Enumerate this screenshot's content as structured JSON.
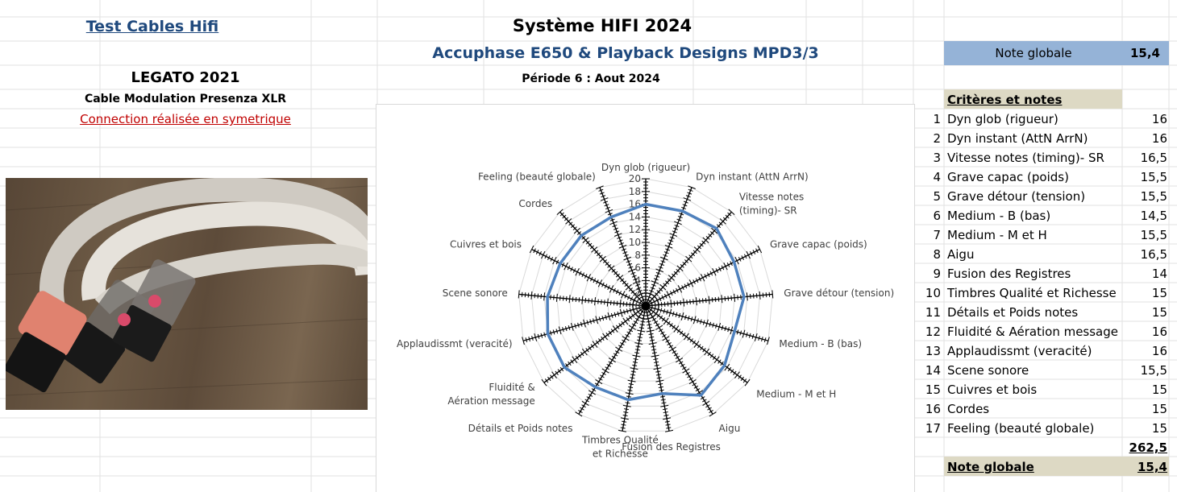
{
  "header": {
    "left_title": "Test Cables Hifi",
    "system_title": "Système HIFI 2024",
    "system_subtitle": "Accuphase E650 & Playback Designs MPD3/3",
    "period": "Période 6 : Aout 2024",
    "product": "LEGATO 2021",
    "product_desc": "Cable Modulation Presenza XLR",
    "connection": "Connection réalisée en symetrique"
  },
  "summary": {
    "top_label": "Note globale",
    "top_value": "15,4",
    "criteria_header": "Critères et notes",
    "total": "262,5",
    "bottom_label": "Note globale",
    "bottom_value": "15,4"
  },
  "criteria": [
    {
      "n": "1",
      "label": "Dyn glob (rigueur)",
      "score": "16"
    },
    {
      "n": "2",
      "label": "Dyn instant (AttN ArrN)",
      "score": "16"
    },
    {
      "n": "3",
      "label": "Vitesse notes (timing)- SR",
      "score": "16,5"
    },
    {
      "n": "4",
      "label": "Grave capac (poids)",
      "score": "15,5"
    },
    {
      "n": "5",
      "label": "Grave détour (tension)",
      "score": "15,5"
    },
    {
      "n": "6",
      "label": "Medium - B (bas)",
      "score": "14,5"
    },
    {
      "n": "7",
      "label": "Medium - M et H",
      "score": "15,5"
    },
    {
      "n": "8",
      "label": "Aigu",
      "score": "16,5"
    },
    {
      "n": "9",
      "label": "Fusion des Registres",
      "score": "14"
    },
    {
      "n": "10",
      "label": "Timbres Qualité et Richesse",
      "score": "15"
    },
    {
      "n": "11",
      "label": "Détails et Poids notes",
      "score": "15"
    },
    {
      "n": "12",
      "label": "Fluidité & Aération message",
      "score": "16"
    },
    {
      "n": "13",
      "label": "Applaudissmt (veracité)",
      "score": "16"
    },
    {
      "n": "14",
      "label": "Scene sonore",
      "score": "15,5"
    },
    {
      "n": "15",
      "label": "Cuivres et bois",
      "score": "15"
    },
    {
      "n": "16",
      "label": "Cordes",
      "score": "15"
    },
    {
      "n": "17",
      "label": "Feeling (beauté globale)",
      "score": "15"
    }
  ],
  "chart_data": {
    "type": "radar",
    "categories": [
      "Dyn glob (rigueur)",
      "Dyn instant (AttN ArrN)",
      "Vitesse notes (timing)- SR",
      "Grave capac (poids)",
      "Grave détour (tension)",
      "Medium - B (bas)",
      "Medium - M et H",
      "Aigu",
      "Fusion des Registres",
      "Timbres Qualité et Richesse",
      "Détails et Poids notes",
      "Fluidité & Aération message",
      "Applaudissmt (veracité)",
      "Scene sonore",
      "Cuivres et bois",
      "Cordes",
      "Feeling (beauté globale)"
    ],
    "values": [
      16,
      16,
      16.5,
      15.5,
      15.5,
      14.5,
      15.5,
      16.5,
      14,
      15,
      15,
      16,
      16,
      15.5,
      15,
      15,
      15
    ],
    "rlim": [
      0,
      20
    ],
    "ticks": [
      "0",
      "2",
      "4",
      "6",
      "8",
      "10",
      "12",
      "14",
      "16",
      "18",
      "20"
    ],
    "series_color": "#4f81bd",
    "grid": true,
    "legend": "none"
  }
}
